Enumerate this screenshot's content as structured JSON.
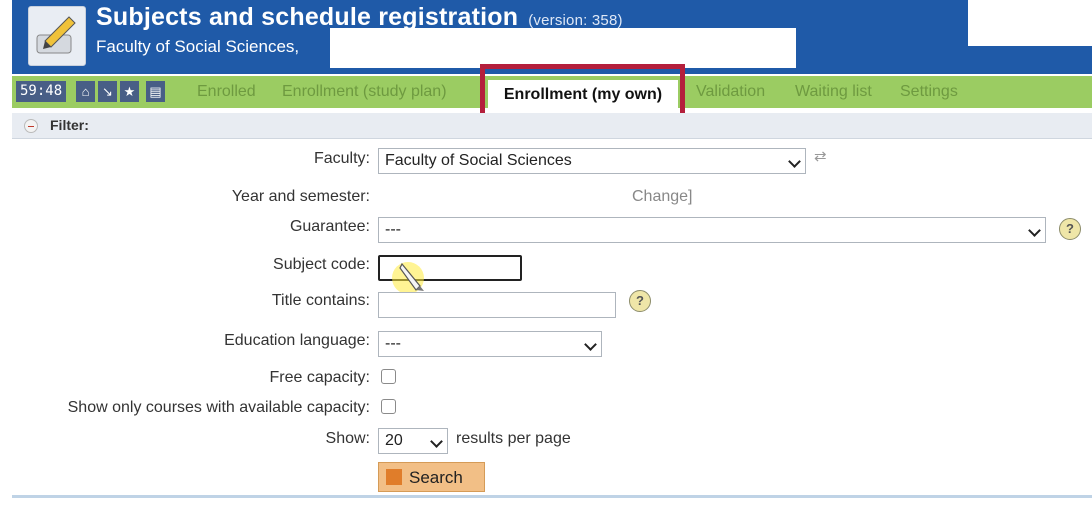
{
  "header": {
    "title": "Subjects and schedule registration",
    "version": "(version: 358)",
    "subtitle": "Faculty of Social Sciences,"
  },
  "nav": {
    "timer": "59:48",
    "items": [
      "Enrolled",
      "Enrollment (study plan)",
      "Enrollment (my own)",
      "Validation",
      "Waiting list",
      "Settings"
    ],
    "icons": [
      "home-icon",
      "arrow-icon",
      "star-icon",
      "print-icon"
    ]
  },
  "filter": {
    "label": "Filter:"
  },
  "form": {
    "faculty_label": "Faculty:",
    "faculty_value": "Faculty of Social Sciences",
    "year_label": "Year and semester:",
    "year_change": "Change]",
    "guarantee_label": "Guarantee:",
    "guarantee_value": "---",
    "subject_code_label": "Subject code:",
    "subject_code_value": "",
    "title_label": "Title contains:",
    "title_value": "",
    "language_label": "Education language:",
    "language_value": "---",
    "free_capacity_label": "Free capacity:",
    "available_label": "Show only courses with available capacity:",
    "show_label": "Show:",
    "show_value": "20",
    "results_label": "results per page",
    "search_label": "Search"
  },
  "colors": {
    "header_blue": "#1f5aa8",
    "nav_green": "#9bcc62",
    "highlight_red": "#b41f3c",
    "search_orange": "#f2bf86"
  }
}
